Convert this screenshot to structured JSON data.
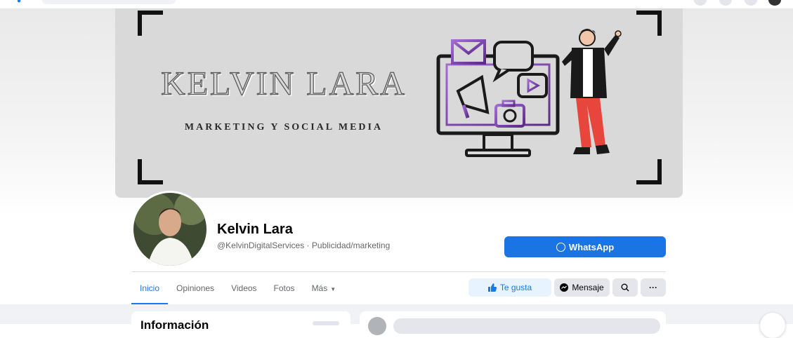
{
  "cover": {
    "title": "KELVIN LARA",
    "subtitle": "MARKETING Y SOCIAL MEDIA"
  },
  "profile": {
    "name": "Kelvin Lara",
    "handle": "@KelvinDigitalServices · Publicidad/marketing"
  },
  "cta": {
    "whatsapp_label": "WhatsApp"
  },
  "tabs": [
    {
      "label": "Inicio",
      "active": true
    },
    {
      "label": "Opiniones"
    },
    {
      "label": "Videos"
    },
    {
      "label": "Fotos"
    },
    {
      "label": "Más"
    }
  ],
  "actions": {
    "like_label": "Te gusta",
    "message_label": "Mensaje"
  },
  "info_card": {
    "title": "Información"
  },
  "colors": {
    "accent": "#1b74e4",
    "cover_bg": "#d9d9d9"
  },
  "icons": {
    "like": "thumbs-up-icon",
    "message": "messenger-icon",
    "search": "search-icon",
    "more": "more-icon",
    "whatsapp": "whatsapp-icon"
  }
}
